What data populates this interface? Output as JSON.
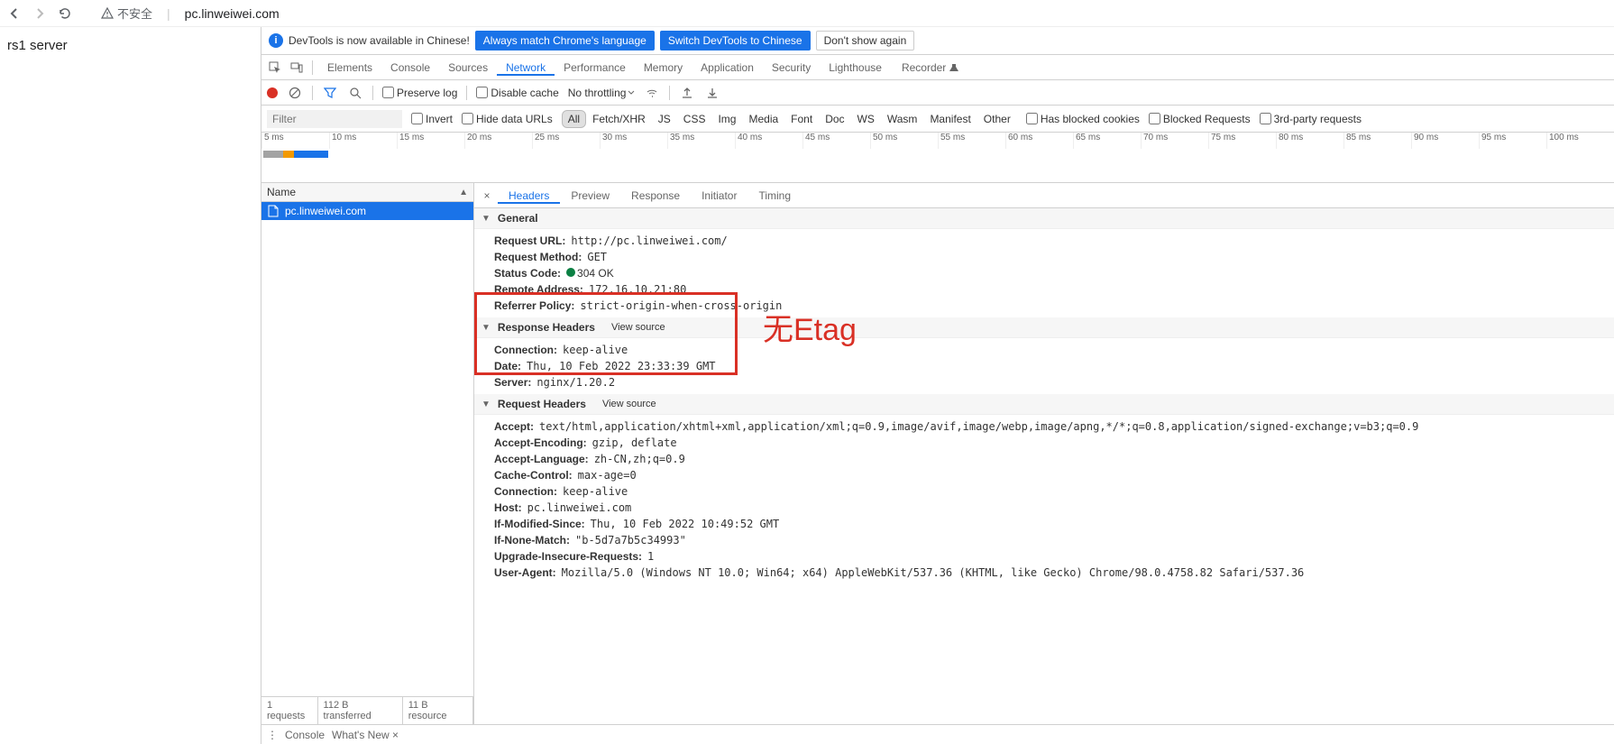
{
  "browser": {
    "secure_text": "不安全",
    "url": "pc.linweiwei.com"
  },
  "page": {
    "content": "rs1 server"
  },
  "infobar": {
    "text": "DevTools is now available in Chinese!",
    "btn1": "Always match Chrome's language",
    "btn2": "Switch DevTools to Chinese",
    "btn3": "Don't show again"
  },
  "tabs": [
    "Elements",
    "Console",
    "Sources",
    "Network",
    "Performance",
    "Memory",
    "Application",
    "Security",
    "Lighthouse"
  ],
  "tabs_active": "Network",
  "recorder_label": "Recorder",
  "toolbar": {
    "preserve_log": "Preserve log",
    "disable_cache": "Disable cache",
    "no_throttling": "No throttling"
  },
  "filter": {
    "placeholder": "Filter",
    "invert": "Invert",
    "hide_data": "Hide data URLs",
    "types": [
      "All",
      "Fetch/XHR",
      "JS",
      "CSS",
      "Img",
      "Media",
      "Font",
      "Doc",
      "WS",
      "Wasm",
      "Manifest",
      "Other"
    ],
    "blocked_cookies": "Has blocked cookies",
    "blocked_req": "Blocked Requests",
    "third_party": "3rd-party requests"
  },
  "timeline_ticks": [
    "5 ms",
    "10 ms",
    "15 ms",
    "20 ms",
    "25 ms",
    "30 ms",
    "35 ms",
    "40 ms",
    "45 ms",
    "50 ms",
    "55 ms",
    "60 ms",
    "65 ms",
    "70 ms",
    "75 ms",
    "80 ms",
    "85 ms",
    "90 ms",
    "95 ms",
    "100 ms"
  ],
  "name_header": "Name",
  "requests": [
    {
      "name": "pc.linweiwei.com"
    }
  ],
  "list_footer": {
    "count": "1 requests",
    "transferred": "112 B transferred",
    "resource": "11 B resource"
  },
  "detail_tabs": [
    "Headers",
    "Preview",
    "Response",
    "Initiator",
    "Timing"
  ],
  "detail_active": "Headers",
  "general": {
    "title": "General",
    "request_url_k": "Request URL:",
    "request_url_v": "http://pc.linweiwei.com/",
    "request_method_k": "Request Method:",
    "request_method_v": "GET",
    "status_code_k": "Status Code:",
    "status_code_v": "304 OK",
    "remote_addr_k": "Remote Address:",
    "remote_addr_v": "172.16.10.21:80",
    "referrer_k": "Referrer Policy:",
    "referrer_v": "strict-origin-when-cross-origin"
  },
  "response_headers": {
    "title": "Response Headers",
    "view_source": "View source",
    "connection_k": "Connection:",
    "connection_v": "keep-alive",
    "date_k": "Date:",
    "date_v": "Thu, 10 Feb 2022 23:33:39 GMT",
    "server_k": "Server:",
    "server_v": "nginx/1.20.2"
  },
  "request_headers": {
    "title": "Request Headers",
    "view_source": "View source",
    "accept_k": "Accept:",
    "accept_v": "text/html,application/xhtml+xml,application/xml;q=0.9,image/avif,image/webp,image/apng,*/*;q=0.8,application/signed-exchange;v=b3;q=0.9",
    "accept_enc_k": "Accept-Encoding:",
    "accept_enc_v": "gzip, deflate",
    "accept_lang_k": "Accept-Language:",
    "accept_lang_v": "zh-CN,zh;q=0.9",
    "cache_k": "Cache-Control:",
    "cache_v": "max-age=0",
    "conn_k": "Connection:",
    "conn_v": "keep-alive",
    "host_k": "Host:",
    "host_v": "pc.linweiwei.com",
    "ifmod_k": "If-Modified-Since:",
    "ifmod_v": "Thu, 10 Feb 2022 10:49:52 GMT",
    "ifnone_k": "If-None-Match:",
    "ifnone_v": "\"b-5d7a7b5c34993\"",
    "upgrade_k": "Upgrade-Insecure-Requests:",
    "upgrade_v": "1",
    "ua_k": "User-Agent:",
    "ua_v": "Mozilla/5.0 (Windows NT 10.0; Win64; x64) AppleWebKit/537.36 (KHTML, like Gecko) Chrome/98.0.4758.82 Safari/537.36"
  },
  "annotation": "无Etag",
  "drawer": {
    "console": "Console",
    "whatsnew": "What's New"
  }
}
